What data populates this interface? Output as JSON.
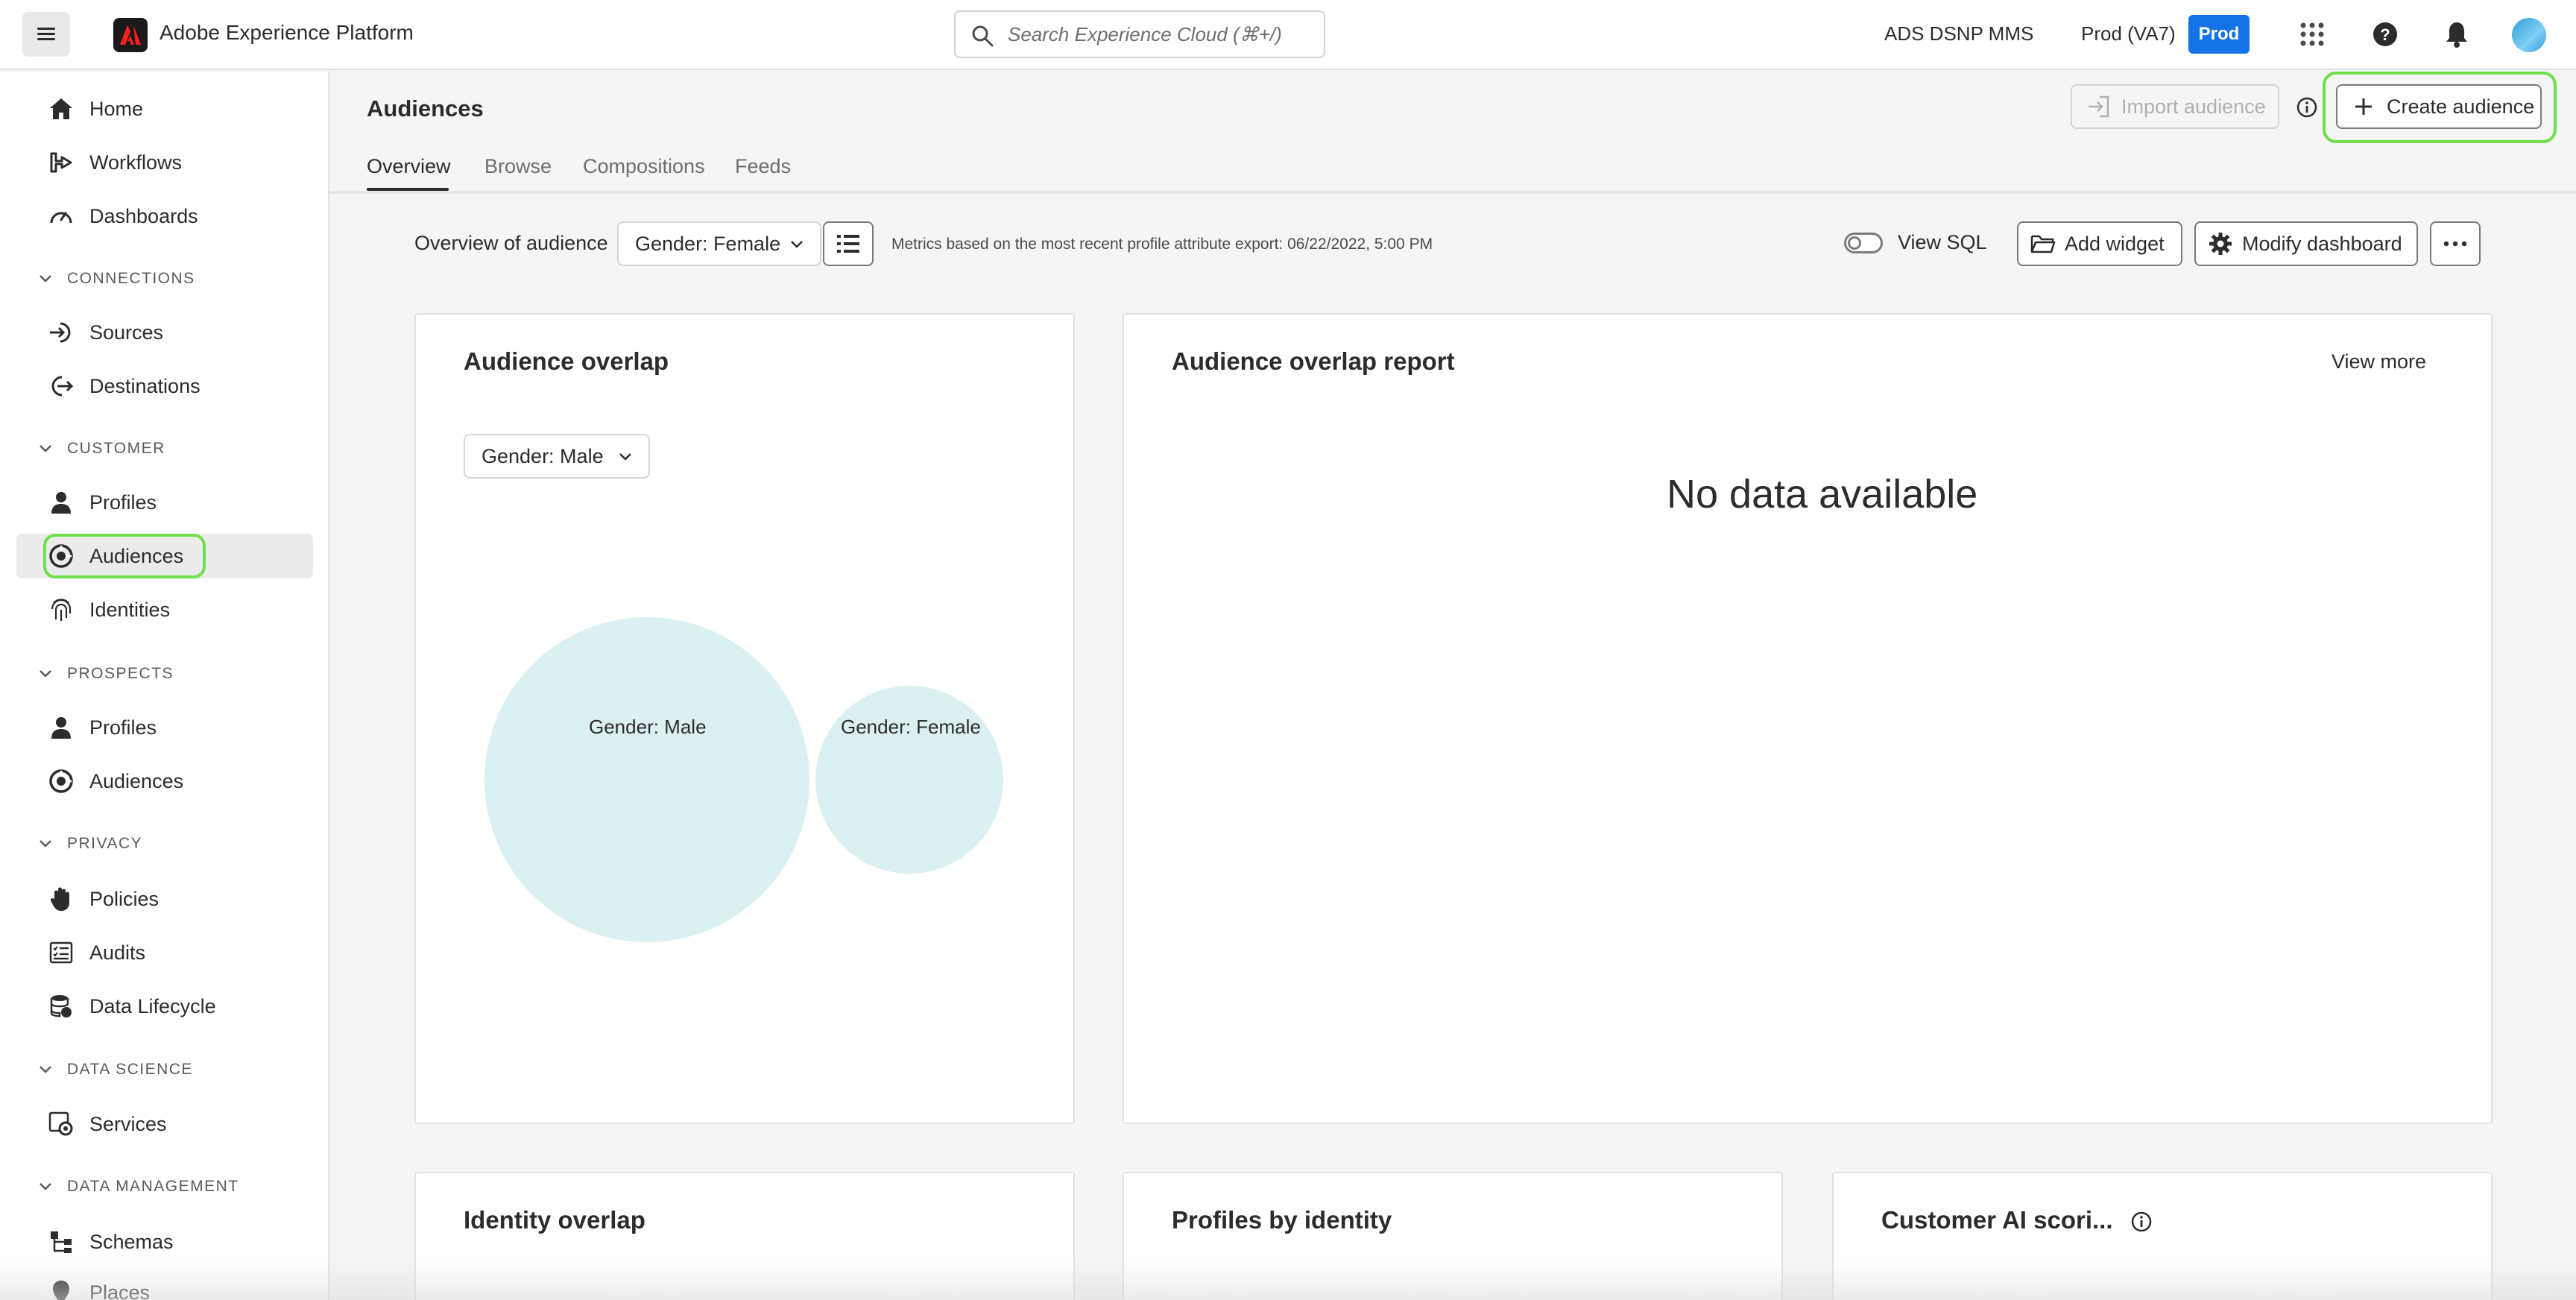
{
  "header": {
    "app_title": "Adobe Experience Platform",
    "search_placeholder": "Search Experience Cloud (⌘+/)",
    "org": "ADS DSNP MMS",
    "sandbox": "Prod (VA7)",
    "sandbox_badge": "Prod",
    "icons": [
      "menu-icon",
      "adobe-logo-icon",
      "search-icon",
      "app-switcher-icon",
      "help-icon",
      "notifications-icon",
      "avatar"
    ]
  },
  "sidebar": {
    "items": [
      {
        "label": "Home",
        "icon": "home-icon"
      },
      {
        "label": "Workflows",
        "icon": "workflows-icon"
      },
      {
        "label": "Dashboards",
        "icon": "dashboards-icon"
      },
      {
        "label": "Sources",
        "icon": "sources-icon"
      },
      {
        "label": "Destinations",
        "icon": "destinations-icon"
      },
      {
        "label": "Profiles",
        "icon": "profile-icon"
      },
      {
        "label": "Audiences",
        "icon": "audiences-icon",
        "active": true
      },
      {
        "label": "Identities",
        "icon": "fingerprint-icon"
      },
      {
        "label": "Profiles",
        "icon": "profile-icon"
      },
      {
        "label": "Audiences",
        "icon": "audiences-icon"
      },
      {
        "label": "Policies",
        "icon": "hand-icon"
      },
      {
        "label": "Audits",
        "icon": "audits-icon"
      },
      {
        "label": "Data Lifecycle",
        "icon": "database-icon"
      },
      {
        "label": "Services",
        "icon": "gear-box-icon"
      },
      {
        "label": "Schemas",
        "icon": "schema-icon"
      },
      {
        "label": "Places",
        "icon": "pin-icon"
      }
    ],
    "sections": [
      "CONNECTIONS",
      "CUSTOMER",
      "PROSPECTS",
      "PRIVACY",
      "DATA SCIENCE",
      "DATA MANAGEMENT"
    ]
  },
  "page": {
    "title": "Audiences",
    "tabs": [
      "Overview",
      "Browse",
      "Compositions",
      "Feeds"
    ],
    "active_tab": "Overview",
    "import_label": "Import audience",
    "create_label": "Create audience"
  },
  "toolbar": {
    "overview_label": "Overview of audience",
    "audience_picker": "Gender: Female",
    "metrics_note": "Metrics based on the most recent profile attribute export: 06/22/2022, 5:00 PM",
    "view_sql": "View SQL",
    "view_sql_on": false,
    "add_widget": "Add widget",
    "modify_dashboard": "Modify dashboard"
  },
  "widgets": {
    "audience_overlap": {
      "title": "Audience overlap",
      "picker": "Gender: Male",
      "circle_a": "Gender: Male",
      "circle_b": "Gender: Female"
    },
    "overlap_report": {
      "title": "Audience overlap report",
      "view_more": "View more",
      "empty": "No data available"
    },
    "identity_overlap": {
      "title": "Identity overlap"
    },
    "profiles_by_identity": {
      "title": "Profiles by identity"
    },
    "customer_ai": {
      "title": "Customer AI scori..."
    }
  },
  "colors": {
    "accent": "#1473e6",
    "highlight": "#6ee04b",
    "venn_fill": "#dbf0f0"
  }
}
